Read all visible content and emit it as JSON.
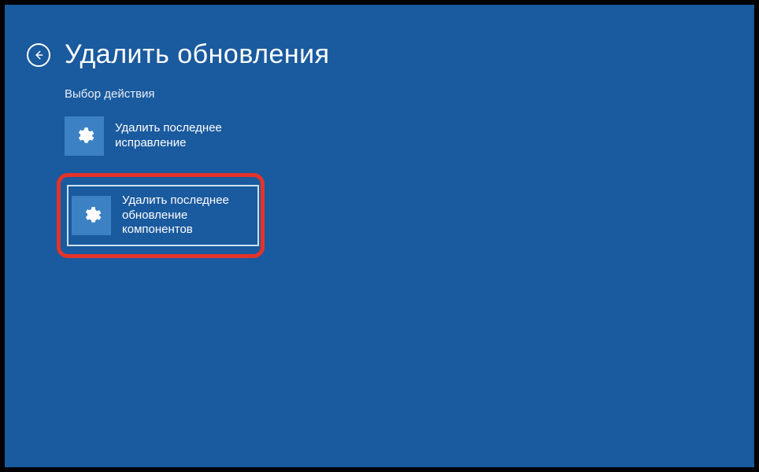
{
  "header": {
    "title": "Удалить обновления"
  },
  "subtitle": "Выбор действия",
  "options": [
    {
      "label": "Удалить последнее исправление"
    },
    {
      "label": "Удалить последнее обновление компонентов"
    }
  ]
}
